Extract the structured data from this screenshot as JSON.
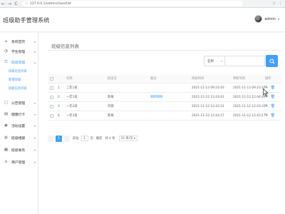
{
  "browser": {
    "back": "←",
    "forward": "→",
    "reload": "C",
    "url_icon": "ⓘ",
    "url": "127.0.0.1/admin/class/list",
    "ext1": "☆",
    "ext2": "⋮"
  },
  "header": {
    "title": "班级助手管理系统",
    "user_name": "admin",
    "caret": "▾"
  },
  "sidebar": {
    "items": [
      {
        "icon": "⌂",
        "label": "系统首页",
        "chevron": "▾"
      },
      {
        "icon": "◔",
        "label": "学生管理",
        "chevron": "▾"
      },
      {
        "icon": "☰",
        "label": "班级管理",
        "chevron": "▴"
      },
      {
        "icon": "▢",
        "label": "公告管理",
        "chevron": "▾"
      },
      {
        "icon": "▤",
        "label": "健康打卡",
        "chevron": "▾"
      },
      {
        "icon": "◉",
        "label": "活动设置",
        "chevron": "▾"
      },
      {
        "icon": "◍",
        "label": "班级相册",
        "chevron": "▾"
      },
      {
        "icon": "▦",
        "label": "班级事务",
        "chevron": "▾"
      },
      {
        "icon": "♙",
        "label": "用户管理",
        "chevron": "▾"
      }
    ],
    "sub_items": [
      "班级信息列表",
      "新增班级",
      "班级信息列表"
    ]
  },
  "main": {
    "panel_title": "班级信息列表",
    "filter": {
      "select_value": "名称",
      "select_caret": "▾",
      "input_placeholder": ""
    },
    "table": {
      "columns": [
        "",
        "名称",
        "班主任",
        "备注",
        "添加时间",
        "更新时间",
        "操作"
      ],
      "rows": [
        {
          "idx": "1",
          "name": "二年1班",
          "teacher": "",
          "note": "",
          "created": "2021-11-13 09:23:16",
          "updated": "2021-11-13 09:23:16"
        },
        {
          "idx": "2",
          "name": "一年1班",
          "teacher": "陈梅",
          "note": "啊啊啊啊",
          "created": "2021-11-12 12:43:41",
          "updated": "2021-11-12 12:44:49"
        },
        {
          "idx": "3",
          "name": "一年2班",
          "teacher": "刘德",
          "note": "",
          "created": "2021-11-12 12:43:33",
          "updated": "2021-11-12 12:43:33"
        },
        {
          "idx": "4",
          "name": "一年3班",
          "teacher": "陈梅",
          "note": "",
          "created": "2021-11-12 12:43:17",
          "updated": "2021-11-12 12:43:17"
        }
      ],
      "op_edit": "✎",
      "op_delete": "🗑"
    },
    "pager": {
      "prev": "‹",
      "current": "1",
      "next": "›",
      "goto_label": "前往",
      "goto_value": "1",
      "page_unit": "页",
      "confirm": "确定",
      "total": "共 4 条",
      "page_size": "10 条/页 ▾"
    }
  },
  "colors": {
    "accent": "#409eff"
  }
}
